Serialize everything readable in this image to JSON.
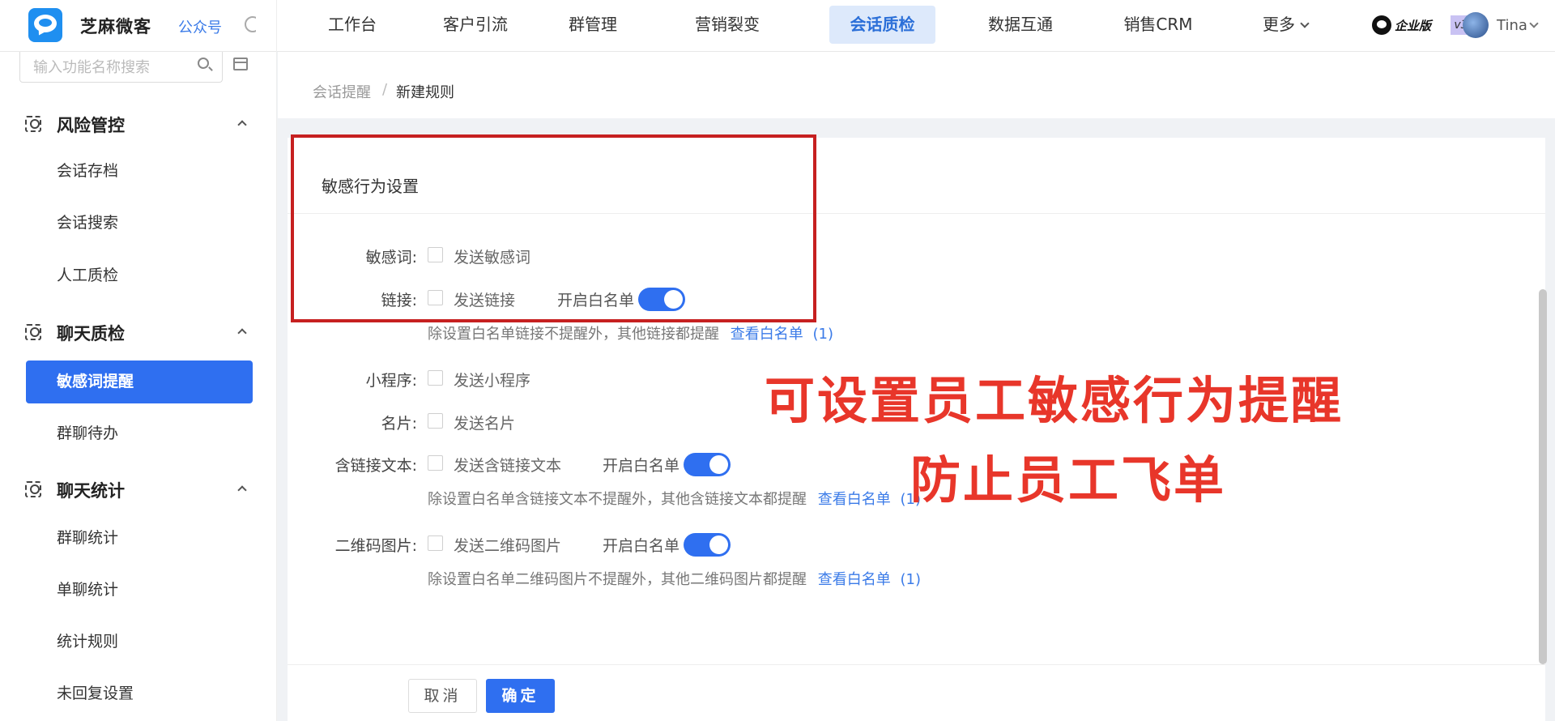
{
  "header": {
    "brand": "芝麻微客",
    "gzh_label": "公众号",
    "nav": [
      {
        "label": "工作台"
      },
      {
        "label": "客户引流"
      },
      {
        "label": "群管理"
      },
      {
        "label": "营销裂变"
      },
      {
        "label": "会话质检",
        "active": true
      },
      {
        "label": "数据互通"
      },
      {
        "label": "销售CRM"
      },
      {
        "label": "更多"
      }
    ],
    "edition_text": "企业版",
    "edition_version": "v3",
    "username": "Tina"
  },
  "sidebar": {
    "search_placeholder": "输入功能名称搜索",
    "groups": [
      {
        "label": "风险管控",
        "items": [
          "会话存档",
          "会话搜索",
          "人工质检"
        ]
      },
      {
        "label": "聊天质检",
        "items": [
          "敏感词提醒",
          "群聊待办"
        ],
        "active_item": "敏感词提醒"
      },
      {
        "label": "聊天统计",
        "items": [
          "群聊统计",
          "单聊统计",
          "统计规则",
          "未回复设置"
        ]
      }
    ]
  },
  "breadcrumb": {
    "parent": "会话提醒",
    "separator": "/",
    "current": "新建规则"
  },
  "form": {
    "section_title": "敏感行为设置",
    "rows": {
      "words": {
        "label": "敏感词:",
        "checkbox": "发送敏感词"
      },
      "link": {
        "label": "链接:",
        "checkbox": "发送链接",
        "whitelist": "开启白名单",
        "hint": "除设置白名单链接不提醒外，其他链接都提醒",
        "view_link": "查看白名单",
        "count": "(1)"
      },
      "miniprogram": {
        "label": "小程序:",
        "checkbox": "发送小程序"
      },
      "card": {
        "label": "名片:",
        "checkbox": "发送名片"
      },
      "linktext": {
        "label": "含链接文本:",
        "checkbox": "发送含链接文本",
        "whitelist": "开启白名单",
        "hint": "除设置白名单含链接文本不提醒外，其他含链接文本都提醒",
        "view_link": "查看白名单",
        "count": "(1)"
      },
      "qrcode": {
        "label": "二维码图片:",
        "checkbox": "发送二维码图片",
        "whitelist": "开启白名单",
        "hint": "除设置白名单二维码图片不提醒外，其他二维码图片都提醒",
        "view_link": "查看白名单",
        "count": "(1)"
      }
    }
  },
  "overlay": {
    "line1": "可设置员工敏感行为提醒",
    "line2": "防止员工飞单"
  },
  "footer": {
    "cancel": "取消",
    "confirm": "确定"
  },
  "colors": {
    "accent": "#2f6ff0",
    "annotation_red": "#e8362a",
    "box_red": "#c62020"
  }
}
